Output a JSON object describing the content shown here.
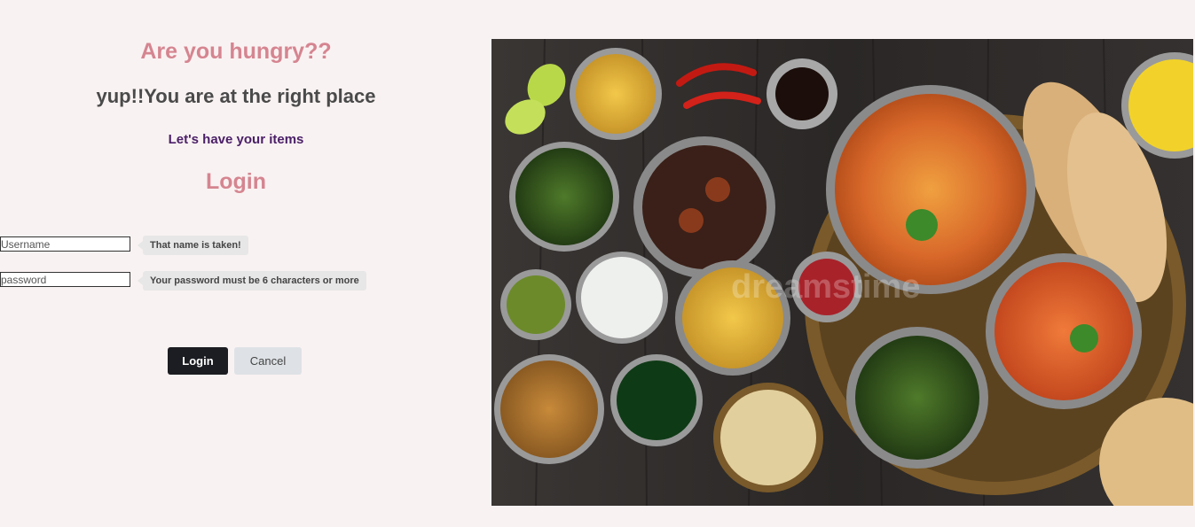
{
  "headings": {
    "hungry": "Are you hungry??",
    "right_place": "yup!!You are at the right place",
    "items": "Let's have your items",
    "login": "Login"
  },
  "form": {
    "username": {
      "value": "",
      "placeholder": "Username",
      "hint": "That name is taken!"
    },
    "password": {
      "value": "",
      "placeholder": "password",
      "hint": "Your password must be 6 characters or more"
    },
    "login_label": "Login",
    "cancel_label": "Cancel"
  },
  "photo": {
    "watermark": "dreamstime"
  },
  "colors": {
    "background": "#f9f2f2",
    "accent_pink": "#d58590",
    "heading_dark": "#4a4a4a",
    "subheading_purple": "#4b2068",
    "login_button": "#1c1d22",
    "cancel_button": "#dee2e6"
  }
}
